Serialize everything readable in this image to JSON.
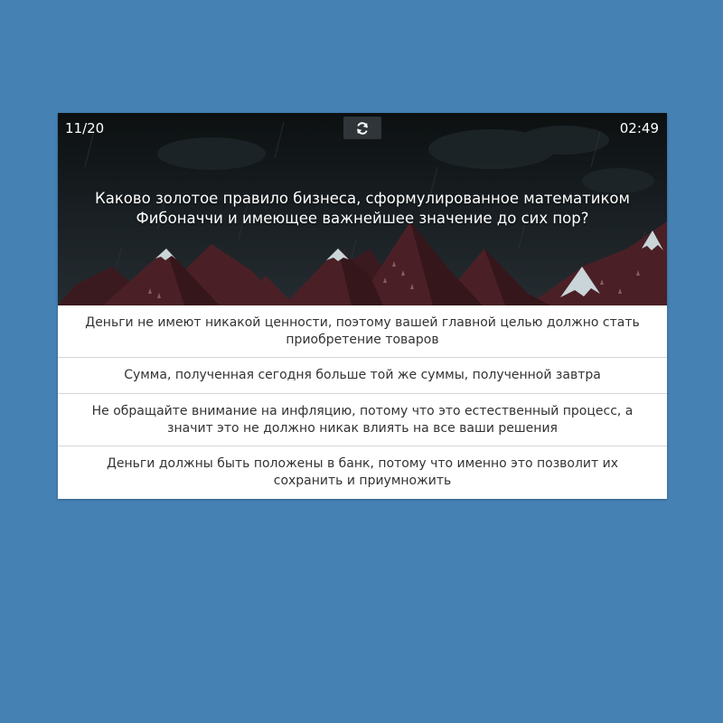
{
  "quiz": {
    "progress": "11/20",
    "timer": "02:49",
    "refresh_icon": "refresh-icon",
    "question": "Каково золотое правило бизнеса, сформулированное математиком Фибоначчи и имеющее важнейшее значение до сих пор?",
    "answers": [
      {
        "label": "Деньги не имеют никакой ценности, поэтому вашей главной целью должно стать приобретение товаров"
      },
      {
        "label": "Сумма, полученная сегодня больше той же суммы, полученной завтра"
      },
      {
        "label": "Не обращайте внимание на инфляцию, потому что это естественный процесс, а значит это не должно никак влиять на все ваши решения"
      },
      {
        "label": "Деньги должны быть положены в банк, потому что именно это позволит их сохранить и приумножить"
      }
    ]
  },
  "colors": {
    "page_background": "#4681b4",
    "header_background": "#111719",
    "answer_background": "#ffffff",
    "mountain": "#4a2026",
    "snow": "#c9d5d8"
  }
}
